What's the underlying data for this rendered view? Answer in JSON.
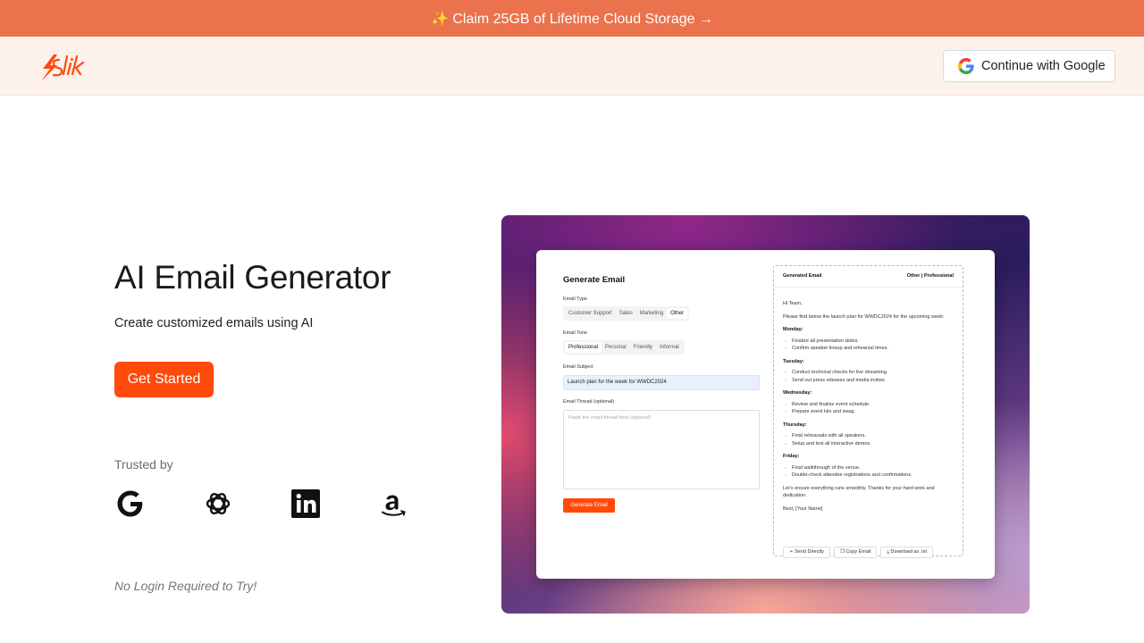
{
  "promo": {
    "text": "✨ Claim 25GB of Lifetime Cloud Storage →"
  },
  "header": {
    "google_label": "Continue with Google"
  },
  "hero": {
    "title": "AI Email Generator",
    "subtitle": "Create customized emails using AI",
    "cta": "Get Started",
    "trusted": "Trusted by",
    "no_login": "No Login Required to Try!"
  },
  "brand_colors": {
    "accent": "#ff4a0c",
    "banner": "#ea724c"
  },
  "logos": [
    "google-logo",
    "openai-logo",
    "linkedin-logo",
    "amazon-logo"
  ],
  "form": {
    "title": "Generate Email",
    "type_label": "Email Type",
    "types": [
      "Customer Support",
      "Sales",
      "Marketing",
      "Other"
    ],
    "tone_label": "Email Tone",
    "tones": [
      "Professional",
      "Personal",
      "Friendly",
      "Informal"
    ],
    "subject_label": "Email Subject",
    "subject_value": "Launch plan for the week for WWDC2024",
    "thread_label": "Email Thread (optional)",
    "thread_placeholder": "Paste the email thread here (optional)",
    "button": "Generate Email"
  },
  "output": {
    "title": "Generated Email",
    "meta": "Other | Professional",
    "greeting": "Hi Team,",
    "intro": "Please find below the launch plan for WWDC2024 for the upcoming week:",
    "days": [
      {
        "name": "Monday:",
        "items": [
          "Finalize all presentation slides.",
          "Confirm speaker lineup and rehearsal times."
        ]
      },
      {
        "name": "Tuesday:",
        "items": [
          "Conduct technical checks for live streaming.",
          "Send out press releases and media invites."
        ]
      },
      {
        "name": "Wednesday:",
        "items": [
          "Review and finalize event schedule.",
          "Prepare event kits and swag."
        ]
      },
      {
        "name": "Thursday:",
        "items": [
          "Final rehearsals with all speakers.",
          "Setup and test all interactive demos."
        ]
      },
      {
        "name": "Friday:",
        "items": [
          "Final walkthrough of the venue.",
          "Double-check attendee registrations and confirmations."
        ]
      }
    ],
    "closing": "Let's ensure everything runs smoothly. Thanks for your hard work and dedication.",
    "signature": "Best, [Your Name]",
    "actions": [
      "Send Directly",
      "Copy Email",
      "Download as .txt"
    ]
  }
}
